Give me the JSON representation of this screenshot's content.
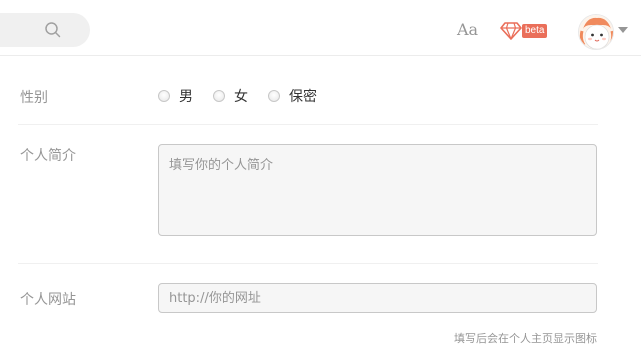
{
  "topbar": {
    "search": {
      "placeholder": ""
    },
    "font_button_label": "Aa",
    "beta_label": "beta",
    "colors": {
      "accent": "#ea6f5a"
    }
  },
  "form": {
    "gender": {
      "label": "性别",
      "options": [
        "男",
        "女",
        "保密"
      ]
    },
    "bio": {
      "label": "个人简介",
      "placeholder": "填写你的个人简介"
    },
    "website": {
      "label": "个人网站",
      "placeholder": "http://你的网址",
      "hint": "填写后会在个人主页显示图标"
    }
  }
}
